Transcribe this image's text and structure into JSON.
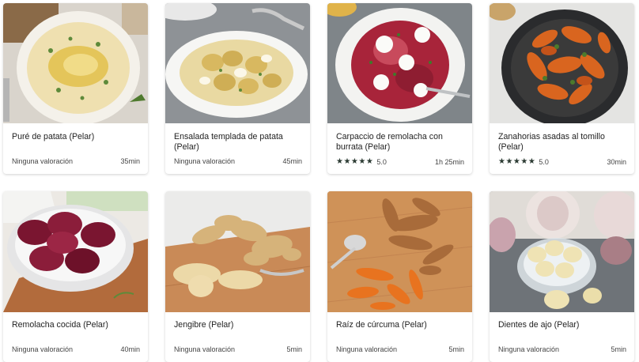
{
  "recipes": [
    {
      "title": "Puré de patata (Pelar)",
      "rating_text": "Ninguna valoración",
      "stars": "",
      "time": "35min"
    },
    {
      "title": "Ensalada templada de patata (Pelar)",
      "rating_text": "Ninguna valoración",
      "stars": "",
      "time": "45min"
    },
    {
      "title": "Carpaccio de remolacha con burrata (Pelar)",
      "rating_text": "5.0",
      "stars": "★★★★★",
      "time": "1h 25min"
    },
    {
      "title": "Zanahorias asadas al tomillo (Pelar)",
      "rating_text": "5.0",
      "stars": "★★★★★",
      "time": "30min"
    },
    {
      "title": "Remolacha cocida (Pelar)",
      "rating_text": "Ninguna valoración",
      "stars": "",
      "time": "40min"
    },
    {
      "title": "Jengibre (Pelar)",
      "rating_text": "Ninguna valoración",
      "stars": "",
      "time": "5min"
    },
    {
      "title": "Raíz de cúrcuma (Pelar)",
      "rating_text": "Ninguna valoración",
      "stars": "",
      "time": "5min"
    },
    {
      "title": "Dientes de ajo (Pelar)",
      "rating_text": "Ninguna valoración",
      "stars": "",
      "time": "5min"
    }
  ],
  "colors": {
    "star": "#2b3a32"
  }
}
